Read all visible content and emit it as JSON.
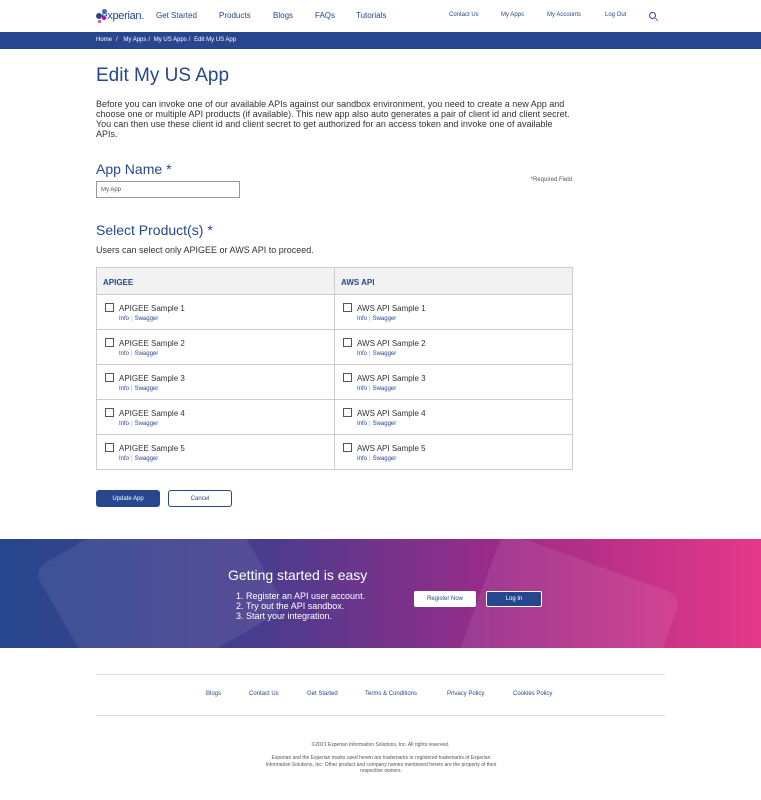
{
  "header": {
    "logo_text": "experian.",
    "nav": {
      "get_started": "Get Started",
      "products": "Products",
      "blogs": "Blogs",
      "faqs": "FAQs",
      "tutorials": "Tutorials",
      "contact_us": "Contact Us",
      "my_apps": "My Apps",
      "my_accounts": "My Accounts",
      "log_out": "Log Out"
    }
  },
  "breadcrumb": {
    "home": "Home",
    "my_apps": "My Apps",
    "my_us_apps": "My US Apps",
    "current": "Edit My US App"
  },
  "page": {
    "title": "Edit My US App",
    "intro": "Before you can invoke one of our available APIs against our sandbox environment, you need to create a new App and choose one or multiple API products (if available). This new app also auto generates a pair of client id and client secret. You can then use these client id and client secret to get authorized for an access token and invoke one of available APIs."
  },
  "app_name": {
    "label": "App Name",
    "required_marker": "*",
    "required_note": "*Required Field",
    "value": "My App"
  },
  "products": {
    "label": "Select Product(s)",
    "required_marker": "*",
    "note": "Users can select only APIGEE or AWS API to proceed.",
    "columns": [
      {
        "header": "APIGEE",
        "items": [
          {
            "name": "APIGEE Sample 1",
            "info": "Info",
            "swagger": "Swagger"
          },
          {
            "name": "APIGEE Sample 2",
            "info": "Info",
            "swagger": "Swagger"
          },
          {
            "name": "APIGEE Sample 3",
            "info": "Info",
            "swagger": "Swagger"
          },
          {
            "name": "APIGEE Sample 4",
            "info": "Info",
            "swagger": "Swagger"
          },
          {
            "name": "APIGEE Sample 5",
            "info": "Info",
            "swagger": "Swagger"
          }
        ]
      },
      {
        "header": "AWS API",
        "items": [
          {
            "name": "AWS API Sample 1",
            "info": "Info",
            "swagger": "Swagger"
          },
          {
            "name": "AWS API Sample 2",
            "info": "Info",
            "swagger": "Swagger"
          },
          {
            "name": "AWS API Sample 3",
            "info": "Info",
            "swagger": "Swagger"
          },
          {
            "name": "AWS API Sample 4",
            "info": "Info",
            "swagger": "Swagger"
          },
          {
            "name": "AWS API Sample 5",
            "info": "Info",
            "swagger": "Swagger"
          }
        ]
      }
    ]
  },
  "actions": {
    "update": "Update App",
    "cancel": "Cancel"
  },
  "banner": {
    "title": "Getting started is easy",
    "steps": [
      "Register an API user account.",
      "Try out the API sandbox.",
      "Start your integration."
    ],
    "register": "Register Now",
    "login": "Log In"
  },
  "footer": {
    "links": {
      "blogs": "Blogs",
      "contact_us": "Contact Us",
      "get_started": "Get Started",
      "terms": "Terms & Conditions",
      "privacy": "Privacy Policy",
      "cookies": "Cookies Policy"
    },
    "copyright": "©2021 Experian Information Solutions, Inc. All rights reserved.",
    "legal": "Experian and the Experian marks used herein are trademarks or registered trademarks of Experian Information Solutions, Inc. Other product and company names mentioned herein are the property of their respective owners."
  },
  "colors": {
    "brand_blue": "#26478d",
    "brand_magenta": "#e63888"
  }
}
